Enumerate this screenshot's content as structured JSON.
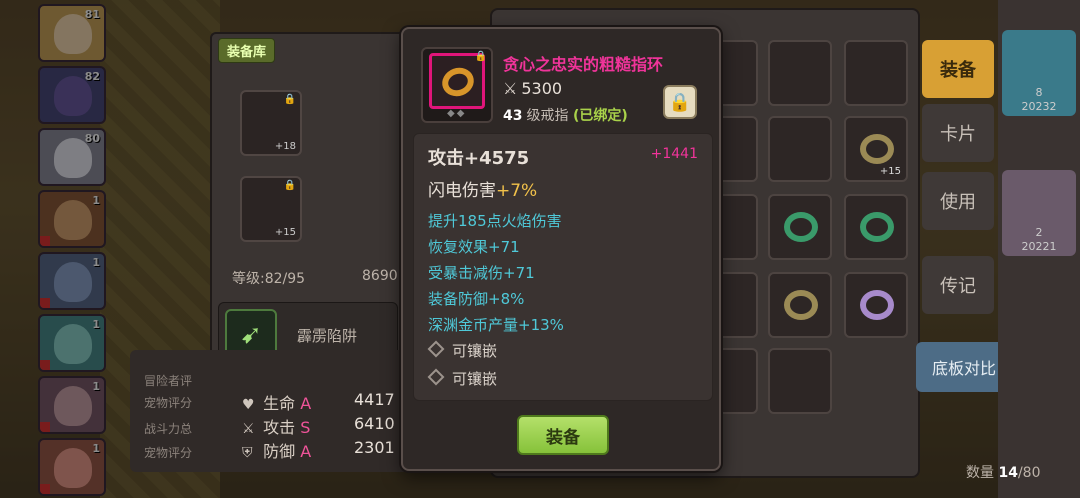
{
  "background": {
    "equip_tab": "装备库",
    "level_label": "等级:82/95",
    "exp_value": "8690",
    "skill_name": "霹雳陷阱",
    "stats": [
      {
        "icon": "heart-icon",
        "label": "生命",
        "grade": "A",
        "value": "4417"
      },
      {
        "icon": "sword-icon",
        "label": "攻击",
        "grade": "S",
        "value": "6410"
      },
      {
        "icon": "shield-icon",
        "label": "防御",
        "grade": "A",
        "value": "2301"
      }
    ],
    "side_labels": [
      "冒险者评",
      "宠物评分",
      "战斗力总",
      "宠物评分"
    ],
    "slot_pluses": [
      "+18",
      "+15"
    ],
    "hero_levels": [
      "81",
      "82",
      "80",
      "1",
      "1",
      "1",
      "1",
      "1",
      "1"
    ]
  },
  "inventory": {
    "side_buttons": [
      "装备",
      "卡片",
      "使用",
      "传记"
    ],
    "compare_button": "底板对比",
    "quantity_label": "数量",
    "quantity_current": "14",
    "quantity_max": "80",
    "right_numbers": [
      "20232",
      "20221"
    ],
    "right_small": [
      "8",
      "2"
    ],
    "plus_label": "+15"
  },
  "tooltip": {
    "item_name": "贪心之忠实的粗糙指环",
    "power": "5300",
    "level": "43",
    "item_type": "级戒指",
    "bound": "(已绑定)",
    "attack": "攻击+4575",
    "attack_bonus": "+1441",
    "lightning_label": "闪电伤害",
    "lightning_value": "+7%",
    "sub_stats": [
      "提升185点火焰伤害",
      "恢复效果+71",
      "受暴击减伤+71",
      "装备防御+8%",
      "深渊金币产量+13%"
    ],
    "sockets": [
      "可镶嵌",
      "可镶嵌"
    ],
    "equip_button": "装备"
  },
  "colors": {
    "name_magenta": "#f0349a",
    "substat_cyan": "#4fc9d8",
    "bound_green": "#a9d24a",
    "equip_btn_green": "#86c23a"
  }
}
